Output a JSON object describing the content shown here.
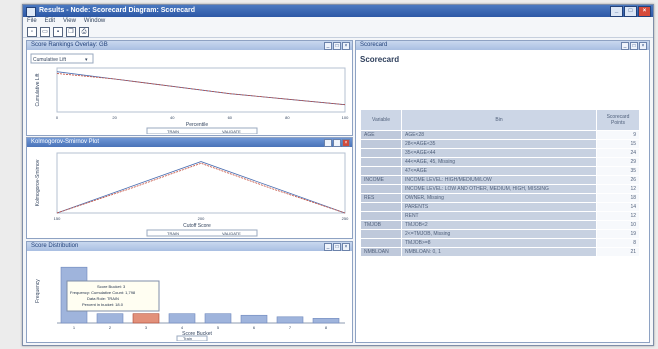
{
  "window": {
    "title": "Results - Node: Scorecard  Diagram: Scorecard"
  },
  "menu": [
    "File",
    "Edit",
    "View",
    "Window"
  ],
  "toolbar": [
    "new-icon",
    "open-icon",
    "save-icon",
    "copy-icon",
    "print-icon"
  ],
  "panels": {
    "top_left": {
      "title": "Score Rankings Overlay: GB",
      "dropdown": "Cumulative Lift",
      "xlabel": "Percentile",
      "ylabel": "Cumulative Lift",
      "legend": [
        "TRAIN",
        "VALIDATE"
      ]
    },
    "mid_left": {
      "title": "Kolmogorov-Smirnov Plot",
      "xlabel": "Cutoff Score",
      "ylabel": "Kolmogorov-Smirnov",
      "legend": [
        "TRAIN",
        "VALIDATE"
      ]
    },
    "bottom_left": {
      "title": "Score Distribution",
      "xlabel": "Score Bucket",
      "ylabel": "Frequency",
      "legend": "Train",
      "tooltip": [
        "Score Bucket: 3",
        "Frequency: Cumulative Count: 1,798",
        "Data Role: TRAIN",
        "Percent in bucket: 18.0"
      ]
    },
    "right": {
      "title": "Scorecard",
      "heading": "Scorecard",
      "columns": [
        "Variable",
        "Bin",
        "Scorecard Points"
      ]
    }
  },
  "scorecard_rows": [
    {
      "var": "AGE",
      "bin": "AGE<28",
      "pts": "9"
    },
    {
      "var": "",
      "bin": "28<=AGE<35",
      "pts": "15"
    },
    {
      "var": "",
      "bin": "35<=AGE<44",
      "pts": "24"
    },
    {
      "var": "",
      "bin": "44<=AGE, 45, Missing",
      "pts": "29"
    },
    {
      "var": "",
      "bin": "47<=AGE",
      "pts": "35"
    },
    {
      "var": "INCOME",
      "bin": "INCOME LEVEL: HIGH/MEDIUM/LOW",
      "pts": "26"
    },
    {
      "var": "",
      "bin": "INCOME LEVEL: LOW AND OTHER, MEDIUM, HIGH, MISSING",
      "pts": "12"
    },
    {
      "var": "RES",
      "bin": "OWNER, Missing",
      "pts": "18"
    },
    {
      "var": "",
      "bin": "PARENTS",
      "pts": "14"
    },
    {
      "var": "",
      "bin": "RENT",
      "pts": "12"
    },
    {
      "var": "TMJOB",
      "bin": "TMJOB<2",
      "pts": "10"
    },
    {
      "var": "",
      "bin": "2<=TMJOB, Missing",
      "pts": "19"
    },
    {
      "var": "",
      "bin": "TMJOB>=8",
      "pts": "8"
    },
    {
      "var": "NMBLOAN",
      "bin": "NMBLOAN: 0, 1",
      "pts": "21"
    }
  ],
  "chart_data": [
    {
      "type": "line",
      "title": "Score Rankings Overlay: GB",
      "xlabel": "Percentile",
      "ylabel": "Cumulative Lift",
      "x": [
        0,
        20,
        40,
        60,
        80,
        100
      ],
      "xticks": [
        "0",
        "20",
        "40",
        "60",
        "80",
        "100"
      ],
      "series": [
        {
          "name": "TRAIN",
          "values": [
            1.9,
            1.7,
            1.5,
            1.3,
            1.15,
            1.0
          ]
        },
        {
          "name": "VALIDATE",
          "values": [
            1.85,
            1.7,
            1.5,
            1.3,
            1.15,
            1.0
          ]
        }
      ],
      "ylim": [
        0.8,
        2.0
      ]
    },
    {
      "type": "line",
      "title": "Kolmogorov-Smirnov Plot",
      "xlabel": "Cutoff Score",
      "ylabel": "Kolmogorov-Smirnov",
      "x": [
        150,
        175,
        200,
        225,
        250
      ],
      "xticks": [
        "150",
        "200",
        "250"
      ],
      "series": [
        {
          "name": "TRAIN",
          "values": [
            0.0,
            0.15,
            0.3,
            0.15,
            0.0
          ]
        },
        {
          "name": "VALIDATE",
          "values": [
            0.0,
            0.14,
            0.29,
            0.14,
            0.0
          ]
        }
      ],
      "ylim": [
        0,
        0.35
      ]
    },
    {
      "type": "bar",
      "title": "Score Distribution",
      "xlabel": "Score Bucket",
      "ylabel": "Frequency",
      "categories": [
        "1",
        "2",
        "3",
        "4",
        "5",
        "6",
        "7",
        "8"
      ],
      "values": [
        0.18,
        0.03,
        0.03,
        0.03,
        0.03,
        0.025,
        0.02,
        0.015
      ],
      "highlight": 3,
      "ylim": [
        0,
        0.2
      ]
    }
  ]
}
